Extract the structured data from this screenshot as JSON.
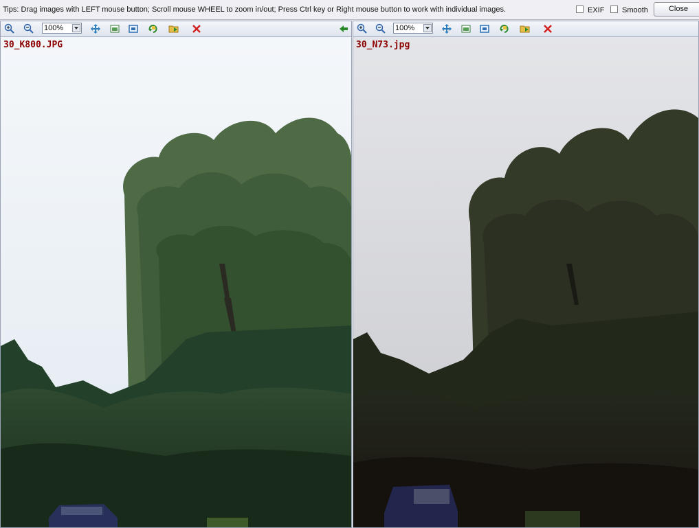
{
  "tips": "Tips: Drag images with LEFT mouse button; Scroll mouse WHEEL to zoom in/out; Press Ctrl key or Right mouse button to work with individual images.",
  "exif_label": "EXIF",
  "smooth_label": "Smooth",
  "close_label": "Close",
  "panes": [
    {
      "zoom": "100%",
      "filename": "30_K800.JPG"
    },
    {
      "zoom": "100%",
      "filename": "30_N73.jpg"
    }
  ],
  "colors": {
    "filename": "#8b0000",
    "delete_icon": "#d22020",
    "nav_icon": "#2a8a2a"
  }
}
